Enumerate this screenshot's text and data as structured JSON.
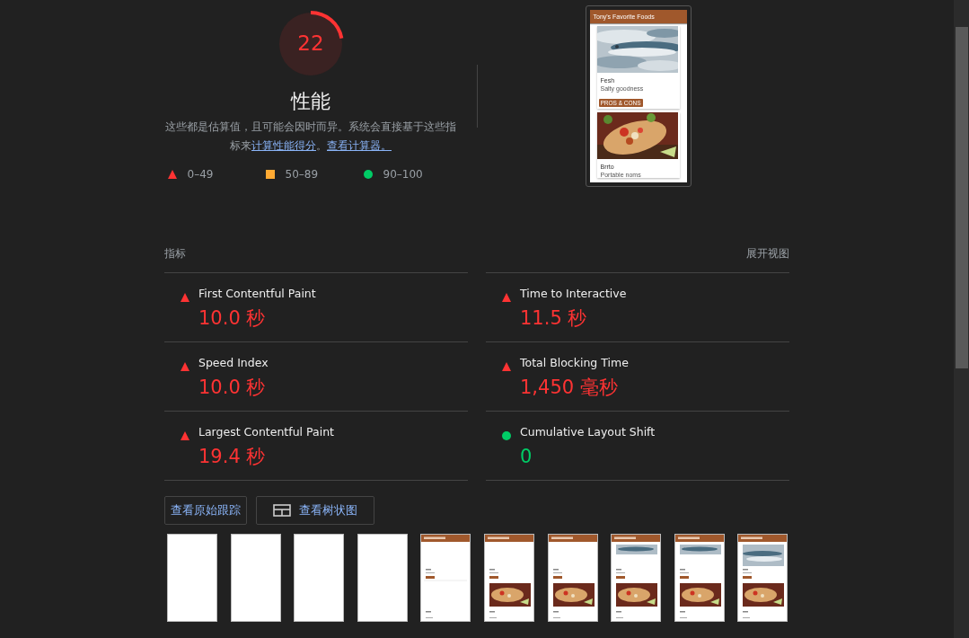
{
  "gauge": {
    "score": "22",
    "level": 0.22,
    "kind": "fail"
  },
  "category": {
    "title": "性能",
    "description": [
      {
        "kind": "text",
        "text": "这些都是估算值，且可能会因时而异。系统会直接基于这些指标来"
      },
      {
        "kind": "link",
        "text": "计算性能得分"
      },
      {
        "kind": "text",
        "text": "。"
      },
      {
        "kind": "link",
        "text": "查看计算器。"
      }
    ]
  },
  "legend": [
    {
      "kind": "triangle",
      "label": "0–49",
      "color": "#ff3333"
    },
    {
      "kind": "square",
      "label": "50–89",
      "color": "#ffaa33"
    },
    {
      "kind": "circle",
      "label": "90–100",
      "color": "#00cc66"
    }
  ],
  "screenshot": {
    "header": "Tony's Favorite Foods",
    "cards": [
      {
        "kind": "picture",
        "title": "Fesh",
        "subtitle": "Salty goodness",
        "button": "PROS & CONS"
      },
      {
        "kind": "picture",
        "title": "Brrto",
        "subtitle": "Portable noms"
      }
    ]
  },
  "metrics": {
    "title": "指标",
    "toggle": "展开视图",
    "items": [
      {
        "name": "First Contentful Paint",
        "value": "10.0 秒",
        "kind": "fail"
      },
      {
        "name": "Time to Interactive",
        "value": "11.5 秒",
        "kind": "fail"
      },
      {
        "name": "Speed Index",
        "value": "10.0 秒",
        "kind": "fail"
      },
      {
        "name": "Total Blocking Time",
        "value": "1,450 毫秒",
        "kind": "fail"
      },
      {
        "name": "Largest Contentful Paint",
        "value": "19.4 秒",
        "kind": "fail"
      },
      {
        "name": "Cumulative Layout Shift",
        "value": "0",
        "kind": "pass"
      }
    ]
  },
  "buttons": [
    {
      "kind": "plain",
      "label": "查看原始跟踪"
    },
    {
      "kind": "treemap",
      "label": "查看树状图"
    }
  ],
  "filmstrip": [
    {
      "kind": "blank"
    },
    {
      "kind": "blank"
    },
    {
      "kind": "blank"
    },
    {
      "kind": "blank"
    },
    {
      "kind": "header"
    },
    {
      "kind": "burrito"
    },
    {
      "kind": "burrito"
    },
    {
      "kind": "fish-small"
    },
    {
      "kind": "fish-small"
    },
    {
      "kind": "fish"
    }
  ]
}
